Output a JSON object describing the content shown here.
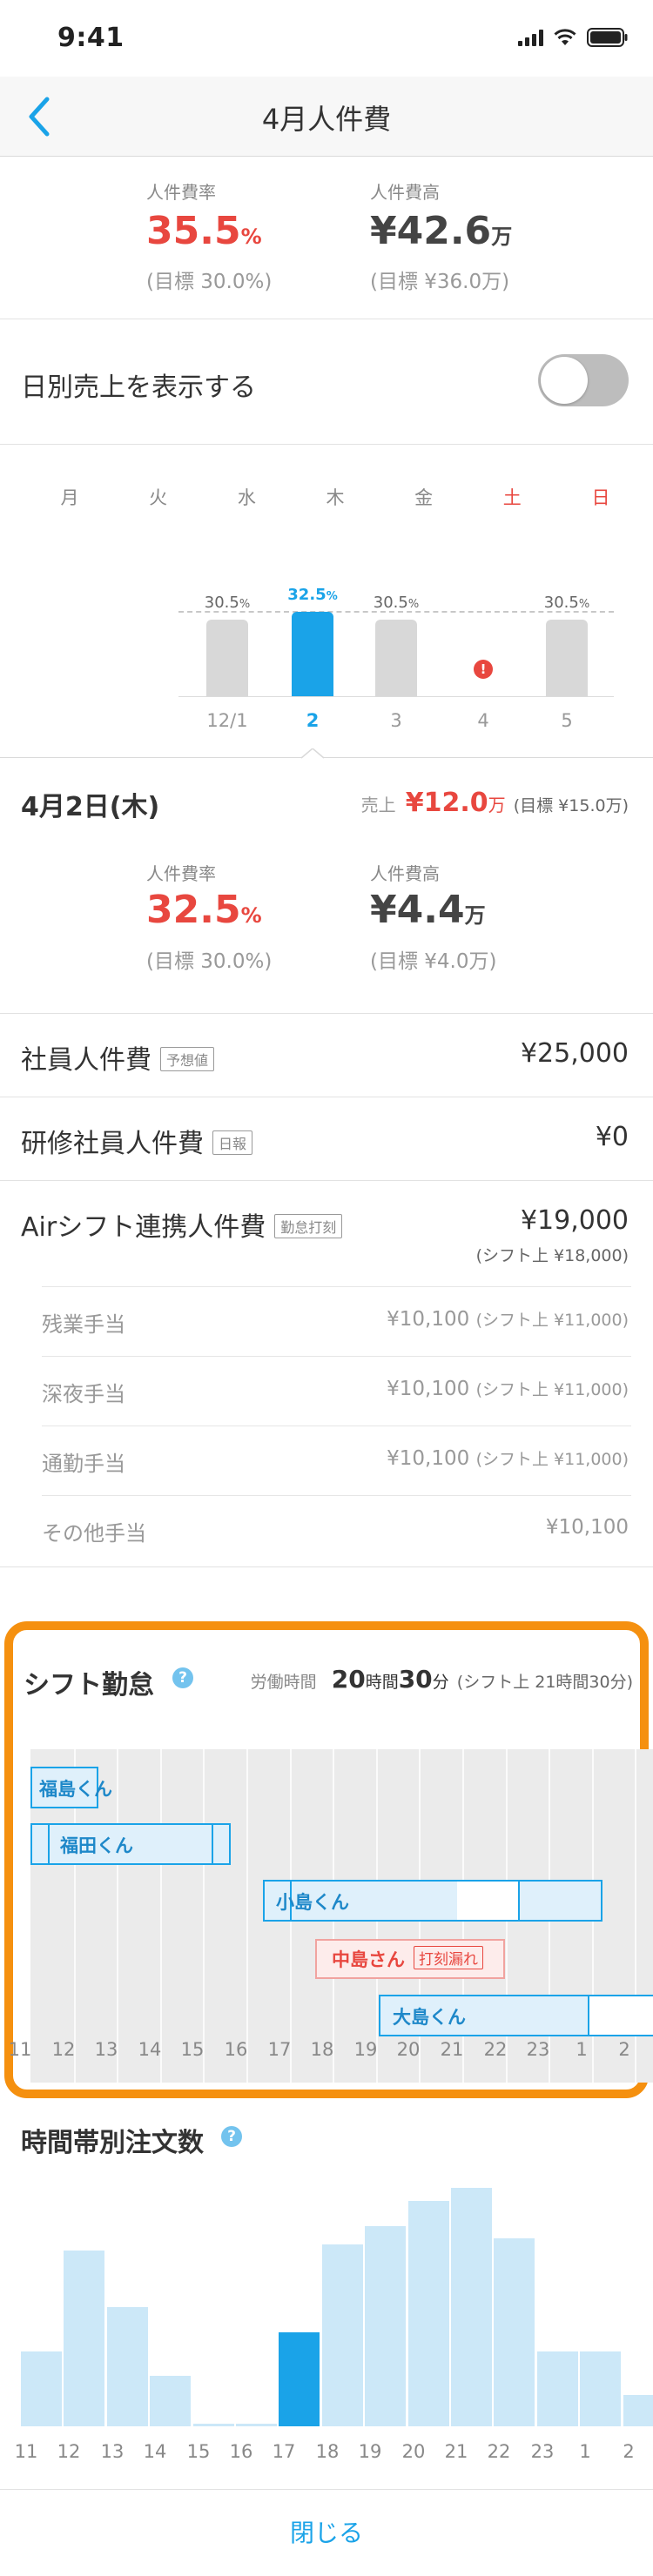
{
  "status_bar": {
    "time": "9:41"
  },
  "nav": {
    "title": "4月人件費"
  },
  "month_summary": {
    "rate_label": "人件費率",
    "rate_value": "35.5",
    "rate_unit": "%",
    "rate_target": "(目標 30.0%)",
    "cost_label": "人件費高",
    "cost_value": "¥42.6",
    "cost_unit": "万",
    "cost_target": "(目標 ¥36.0万)"
  },
  "daily_sales_toggle": {
    "label": "日別売上を表示する",
    "on": false
  },
  "week_chart": {
    "weekdays": [
      "月",
      "火",
      "水",
      "木",
      "金",
      "土",
      "日"
    ],
    "weekend_color": "#e8473f",
    "bars": [
      {
        "day": "12/1",
        "value": "30.5",
        "unit": "%",
        "rate": 30.5,
        "selected": false
      },
      {
        "day": "2",
        "value": "32.5",
        "unit": "%",
        "rate": 32.5,
        "selected": true
      },
      {
        "day": "3",
        "value": "30.5",
        "unit": "%",
        "rate": 30.5,
        "selected": false
      },
      {
        "day": "4",
        "value": "",
        "unit": "",
        "rate": 0,
        "selected": false,
        "alert": true
      },
      {
        "day": "5",
        "value": "30.5",
        "unit": "%",
        "rate": 30.5,
        "selected": false
      }
    ],
    "target_rate": 30.0
  },
  "day_detail": {
    "date": "4月2日(木)",
    "sales_label": "売上",
    "sales_value": "¥12.0",
    "sales_unit": "万",
    "sales_target": "(目標 ¥15.0万)",
    "rate_label": "人件費率",
    "rate_value": "32.5",
    "rate_unit": "%",
    "rate_target": "(目標 30.0%)",
    "cost_label": "人件費高",
    "cost_value": "¥4.4",
    "cost_unit": "万",
    "cost_target": "(目標 ¥4.0万)"
  },
  "cost_rows": [
    {
      "title": "社員人件費",
      "tag": "予想値",
      "amount": "¥25,000"
    },
    {
      "title": "研修社員人件費",
      "tag": "日報",
      "amount": "¥0"
    },
    {
      "title": "Airシフト連携人件費",
      "tag": "勤怠打刻",
      "amount": "¥19,000",
      "sub": "(シフト上 ¥18,000)"
    }
  ],
  "allowances": [
    {
      "label": "残業手当",
      "amount": "¥10,100",
      "shift": "(シフト上 ¥11,000)"
    },
    {
      "label": "深夜手当",
      "amount": "¥10,100",
      "shift": "(シフト上 ¥11,000)"
    },
    {
      "label": "通勤手当",
      "amount": "¥10,100",
      "shift": "(シフト上 ¥11,000)"
    },
    {
      "label": "その他手当",
      "amount": "¥10,100",
      "shift": ""
    }
  ],
  "shift_section": {
    "title": "シフト勤怠",
    "work_label": "労働時間",
    "work_hours": "20",
    "hours_unit": "時間",
    "work_minutes": "30",
    "minutes_unit": "分",
    "shift_total": "(シフト上 21時間30分)",
    "hours": [
      "11",
      "12",
      "13",
      "14",
      "15",
      "16",
      "17",
      "18",
      "19",
      "20",
      "21",
      "22",
      "23",
      "1",
      "2"
    ],
    "staff": [
      {
        "name": "福島くん",
        "color": "#1aa3e8"
      },
      {
        "name": "福田くん",
        "color": "#1aa3e8"
      },
      {
        "name": "小島くん",
        "color": "#1aa3e8"
      },
      {
        "name": "中島さん",
        "color": "#e8473f",
        "badge": "打刻漏れ"
      },
      {
        "name": "大島くん",
        "color": "#1aa3e8"
      }
    ]
  },
  "orders_section": {
    "title": "時間帯別注文数",
    "hours": [
      "11",
      "12",
      "13",
      "14",
      "15",
      "16",
      "17",
      "18",
      "19",
      "20",
      "21",
      "22",
      "23",
      "1",
      "2"
    ]
  },
  "chart_data": {
    "type": "bar",
    "title": "時間帯別注文数",
    "categories": [
      "11",
      "12",
      "13",
      "14",
      "15",
      "16",
      "17",
      "18",
      "19",
      "20",
      "21",
      "22",
      "23",
      "1",
      "2"
    ],
    "values": [
      6,
      14,
      9.5,
      4,
      0.2,
      0.2,
      7.5,
      14.5,
      16,
      18,
      19,
      15,
      6,
      6,
      2.5
    ],
    "selected_category": "17",
    "ylim": [
      0,
      20
    ],
    "grid": false
  },
  "footer": {
    "close_label": "閉じる"
  }
}
